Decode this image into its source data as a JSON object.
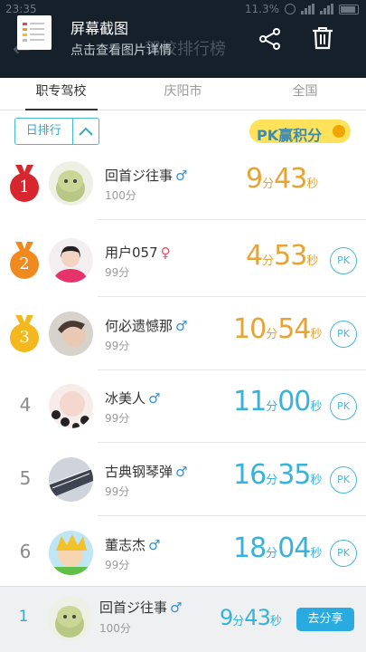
{
  "status_bar": {
    "time": "23:35",
    "battery": "11.3%"
  },
  "app_header": {
    "back_icon": "back-arrow-icon",
    "title": "驾校排行榜"
  },
  "notification": {
    "title": "屏幕截图",
    "subtitle": "点击查看图片详情",
    "share_icon": "share-icon",
    "delete_icon": "trash-icon"
  },
  "tabs": [
    {
      "label": "职专驾校",
      "active": true
    },
    {
      "label": "庆阳市",
      "active": false
    },
    {
      "label": "全国",
      "active": false
    }
  ],
  "filter": {
    "label": "日排行",
    "caret_icon": "chevron-up-icon"
  },
  "pk_badge": {
    "label": "PK赢积分"
  },
  "colors": {
    "accent": "#45b8d8",
    "gold_time": "#e8a331",
    "blue_time": "#35b3dc",
    "medal_1": "#d7262d",
    "medal_2": "#f08a1e",
    "medal_3": "#f2b81e"
  },
  "rows": [
    {
      "rank": "1",
      "medal": true,
      "name": "回首ジ往事",
      "gender": "♂",
      "score": "100分",
      "minutes": "9",
      "min_unit": "分",
      "seconds": "43",
      "sec_unit": "秒",
      "pk": ""
    },
    {
      "rank": "2",
      "medal": true,
      "name": "用户057",
      "gender": "♀",
      "score": "99分",
      "minutes": "4",
      "min_unit": "分",
      "seconds": "53",
      "sec_unit": "秒",
      "pk": "PK"
    },
    {
      "rank": "3",
      "medal": true,
      "name": "何必遗憾那",
      "gender": "♂",
      "score": "99分",
      "minutes": "10",
      "min_unit": "分",
      "seconds": "54",
      "sec_unit": "秒",
      "pk": "PK"
    },
    {
      "rank": "4",
      "medal": false,
      "name": "冰美人",
      "gender": "♂",
      "score": "99分",
      "minutes": "11",
      "min_unit": "分",
      "seconds": "00",
      "sec_unit": "秒",
      "pk": "PK"
    },
    {
      "rank": "5",
      "medal": false,
      "name": "古典钢琴弹",
      "gender": "♂",
      "score": "99分",
      "minutes": "16",
      "min_unit": "分",
      "seconds": "35",
      "sec_unit": "秒",
      "pk": "PK"
    },
    {
      "rank": "6",
      "medal": false,
      "name": "董志杰",
      "gender": "♂",
      "score": "99分",
      "minutes": "18",
      "min_unit": "分",
      "seconds": "04",
      "sec_unit": "秒",
      "pk": "PK"
    }
  ],
  "my_rank": {
    "rank": "1",
    "name": "回首ジ往事",
    "gender": "♂",
    "score": "100分",
    "minutes": "9",
    "min_unit": "分",
    "seconds": "43",
    "sec_unit": "秒",
    "share_label": "去分享"
  }
}
